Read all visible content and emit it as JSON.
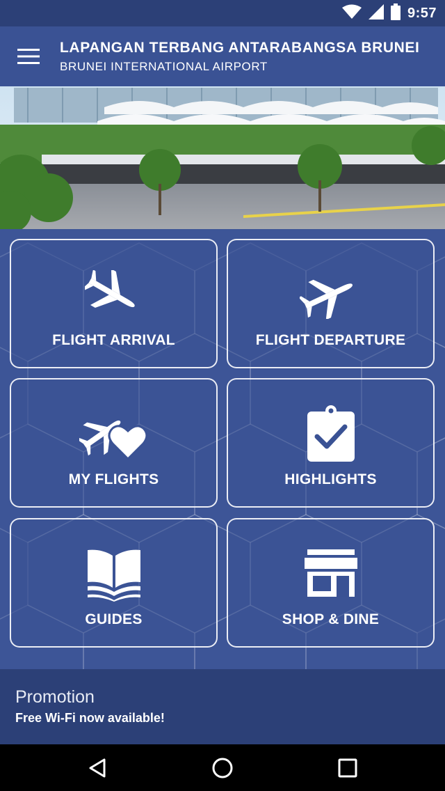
{
  "status_bar": {
    "time": "9:57",
    "icons": [
      "wifi-icon",
      "cell-signal-icon",
      "battery-icon"
    ]
  },
  "app_bar": {
    "menu_icon": "hamburger-menu-icon",
    "title": "LAPANGAN TERBANG ANTARABANGSA BRUNEI",
    "subtitle": "BRUNEI INTERNATIONAL AIRPORT"
  },
  "hero": {
    "image": "airport-terminal-photo"
  },
  "tiles": [
    {
      "label": "FLIGHT ARRIVAL",
      "icon": "plane-landing-icon"
    },
    {
      "label": "FLIGHT DEPARTURE",
      "icon": "plane-takeoff-icon"
    },
    {
      "label": "MY FLIGHTS",
      "icon": "plane-heart-icon"
    },
    {
      "label": "HIGHLIGHTS",
      "icon": "clipboard-check-icon"
    },
    {
      "label": "GUIDES",
      "icon": "open-book-icon"
    },
    {
      "label": "SHOP & DINE",
      "icon": "storefront-icon"
    }
  ],
  "promotion": {
    "title": "Promotion",
    "text": "Free Wi-Fi now available!"
  },
  "nav_bar": {
    "icons": [
      "back-icon",
      "home-icon",
      "recents-icon"
    ]
  },
  "colors": {
    "primary": "#3a5294",
    "dark": "#2c4077"
  }
}
